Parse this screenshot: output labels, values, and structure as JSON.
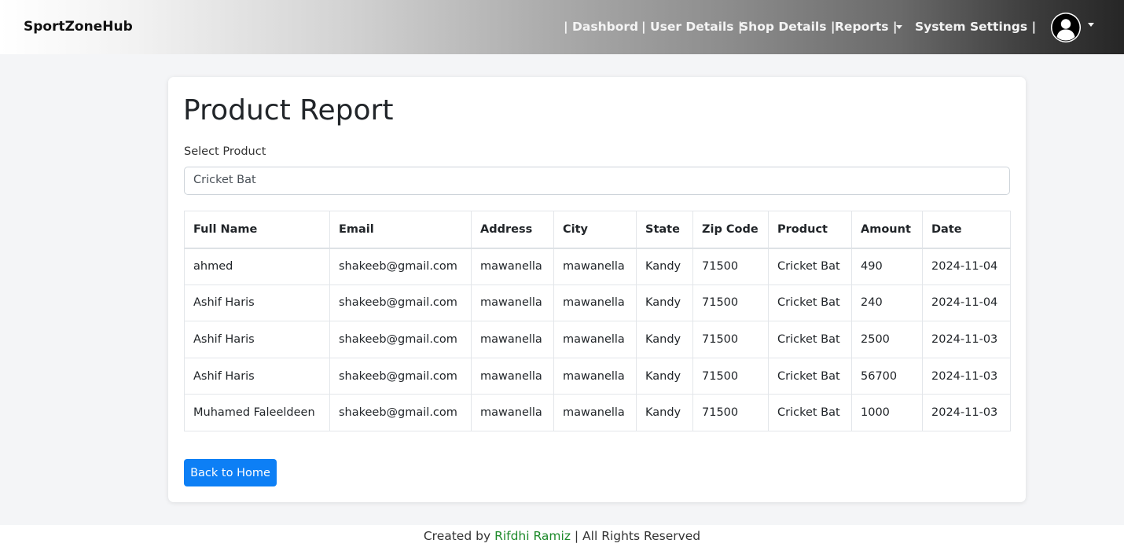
{
  "navbar": {
    "brand": "SportZoneHub",
    "links": [
      {
        "label": "| Dashbord"
      },
      {
        "label": "| User Details |"
      },
      {
        "label": "Shop Details |"
      },
      {
        "label": "Reports |"
      },
      {
        "label": "System Settings |"
      }
    ],
    "avatar_icon": "user-avatar-icon"
  },
  "page": {
    "title": "Product Report",
    "select_label": "Select Product",
    "select_value": "Cricket Bat",
    "back_button": "Back to Home"
  },
  "table": {
    "columns": [
      "Full Name",
      "Email",
      "Address",
      "City",
      "State",
      "Zip Code",
      "Product",
      "Amount",
      "Date"
    ],
    "rows": [
      [
        "ahmed",
        "shakeeb@gmail.com",
        "mawanella",
        "mawanella",
        "Kandy",
        "71500",
        "Cricket Bat",
        "490",
        "2024-11-04"
      ],
      [
        "Ashif Haris",
        "shakeeb@gmail.com",
        "mawanella",
        "mawanella",
        "Kandy",
        "71500",
        "Cricket Bat",
        "240",
        "2024-11-04"
      ],
      [
        "Ashif Haris",
        "shakeeb@gmail.com",
        "mawanella",
        "mawanella",
        "Kandy",
        "71500",
        "Cricket Bat",
        "2500",
        "2024-11-03"
      ],
      [
        "Ashif Haris",
        "shakeeb@gmail.com",
        "mawanella",
        "mawanella",
        "Kandy",
        "71500",
        "Cricket Bat",
        "56700",
        "2024-11-03"
      ],
      [
        "Muhamed Faleeldeen",
        "shakeeb@gmail.com",
        "mawanella",
        "mawanella",
        "Kandy",
        "71500",
        "Cricket Bat",
        "1000",
        "2024-11-03"
      ]
    ]
  },
  "footer": {
    "prefix": "Created by ",
    "author": "Rifdhi Ramiz",
    "suffix": " | All Rights Reserved"
  },
  "colors": {
    "primary_button": "#0d7ff5",
    "footer_author": "#1d8a2a"
  }
}
